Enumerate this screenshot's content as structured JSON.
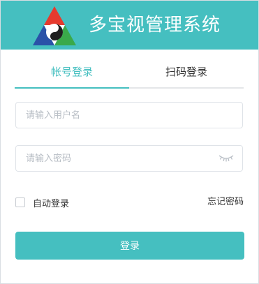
{
  "app": {
    "title": "多宝视管理系统",
    "logo_icon": "triangle-logo-icon"
  },
  "tabs": [
    {
      "label": "帐号登录",
      "active": true
    },
    {
      "label": "扫码登录",
      "active": false
    }
  ],
  "form": {
    "username_placeholder": "请输入用户名",
    "username_value": "",
    "password_placeholder": "请输入密码",
    "password_value": "",
    "password_toggle_icon": "eye-closed-icon",
    "remember_label": "自动登录",
    "remember_checked": false,
    "forgot_label": "忘记密码",
    "submit_label": "登录"
  },
  "colors": {
    "accent": "#45bfc0",
    "text": "#333333",
    "placeholder": "#b8bec5",
    "border": "#dfe3e8"
  }
}
